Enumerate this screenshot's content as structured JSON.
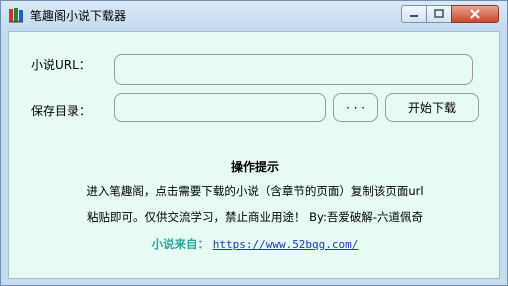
{
  "window": {
    "title": "笔趣阁小说下载器"
  },
  "form": {
    "url_label": "小说URL：",
    "url_value": "",
    "dir_label": "保存目录：",
    "dir_value": "",
    "browse_label": "· · ·",
    "start_label": "开始下载"
  },
  "hint": {
    "title": "操作提示",
    "line1": "进入笔趣阁，点击需要下载的小说（含章节的页面）复制该页面url",
    "line2": "粘贴即可。仅供交流学习，禁止商业用途！ By:吾爱破解-六道佩奇",
    "source_label": "小说来自：",
    "source_url": "https://www.52bqg.com/"
  },
  "colors": {
    "content_bg": "#e6fbf1",
    "link": "#1a36c8",
    "source_label": "#2aa6a0"
  },
  "icons": [
    "app-books-icon",
    "minimize-icon",
    "maximize-icon",
    "close-icon"
  ]
}
